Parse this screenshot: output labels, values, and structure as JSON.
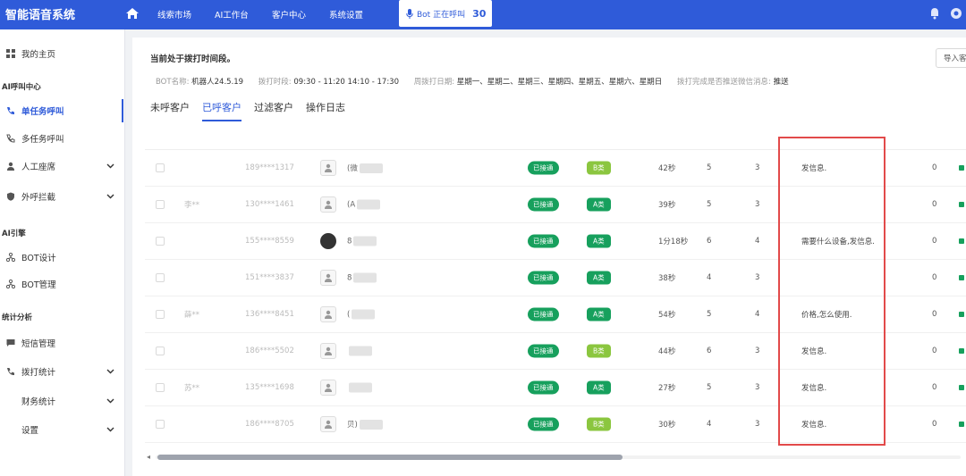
{
  "header": {
    "brand": "智能语音系统",
    "nav": [
      "线索市场",
      "AI工作台",
      "客户中心",
      "系统设置"
    ],
    "call_status": "Bot 正在呼叫",
    "call_count": "30"
  },
  "sidebar": {
    "home": "我的主页",
    "group_call": "AI呼叫中心",
    "single_call": "单任务呼叫",
    "multi_call": "多任务呼叫",
    "agent": "人工座席",
    "outbound_block": "外呼拦截",
    "group_engine": "AI引擎",
    "bot_design": "BOT设计",
    "bot_manage": "BOT管理",
    "group_stats": "统计分析",
    "sms_manage": "短信管理",
    "dial_stats": "拨打统计",
    "finance_stats": "财务统计",
    "settings": "设置"
  },
  "main": {
    "tip": "当前处于拨打时间段。",
    "import_btn": "导入客",
    "info": {
      "bot_label": "BOT名称:",
      "bot_value": "机器人24.5.19",
      "time_label": "拨打时段:",
      "time_value": "09:30 - 11:20 14:10 - 17:30",
      "days_label": "周拨打日期:",
      "days_value": "星期一、星期二、星期三、星期四、星期五、星期六、星期日",
      "wechat_label": "拨打完成是否推送微信消息:",
      "wechat_value": "推送"
    },
    "tabs": [
      "未呼客户",
      "已呼客户",
      "过滤客户",
      "操作日志"
    ]
  },
  "colors": {
    "primary": "#2f5bd9",
    "status_green": "#17a05d",
    "level_a": "#17a05d",
    "level_b": "#8bc63f",
    "highlight_red": "#e24a4a"
  },
  "rows": [
    {
      "name": "",
      "phone": "189****1317",
      "nick": "(微",
      "status": "已接通",
      "level": "B类",
      "level_color": "#8bc63f",
      "duration": "42秒",
      "rounds": "5",
      "effective": "3",
      "intent": "发信息.",
      "count": "0",
      "photo": false
    },
    {
      "name": "李**",
      "phone": "130****1461",
      "nick": "(A",
      "status": "已接通",
      "level": "A类",
      "level_color": "#17a05d",
      "duration": "39秒",
      "rounds": "5",
      "effective": "3",
      "intent": "",
      "count": "0",
      "photo": false
    },
    {
      "name": "",
      "phone": "155****8559",
      "nick": "8",
      "status": "已接通",
      "level": "A类",
      "level_color": "#17a05d",
      "duration": "1分18秒",
      "rounds": "6",
      "effective": "4",
      "intent": "需要什么设备,发信息.",
      "count": "0",
      "photo": true
    },
    {
      "name": "",
      "phone": "151****3837",
      "nick": "8",
      "status": "已接通",
      "level": "A类",
      "level_color": "#17a05d",
      "duration": "38秒",
      "rounds": "4",
      "effective": "3",
      "intent": "",
      "count": "0",
      "photo": false
    },
    {
      "name": "薛**",
      "phone": "136****8451",
      "nick": "(",
      "status": "已接通",
      "level": "A类",
      "level_color": "#17a05d",
      "duration": "54秒",
      "rounds": "5",
      "effective": "4",
      "intent": "价格,怎么使用.",
      "count": "0",
      "photo": false
    },
    {
      "name": "",
      "phone": "186****5502",
      "nick": "",
      "status": "已接通",
      "level": "B类",
      "level_color": "#8bc63f",
      "duration": "44秒",
      "rounds": "6",
      "effective": "3",
      "intent": "发信息.",
      "count": "0",
      "photo": false
    },
    {
      "name": "苏**",
      "phone": "135****1698",
      "nick": "",
      "status": "已接通",
      "level": "A类",
      "level_color": "#17a05d",
      "duration": "27秒",
      "rounds": "5",
      "effective": "3",
      "intent": "发信息.",
      "count": "0",
      "photo": false
    },
    {
      "name": "",
      "phone": "186****8705",
      "nick": "贝)",
      "status": "已接通",
      "level": "B类",
      "level_color": "#8bc63f",
      "duration": "30秒",
      "rounds": "4",
      "effective": "3",
      "intent": "发信息.",
      "count": "0",
      "photo": false
    }
  ]
}
